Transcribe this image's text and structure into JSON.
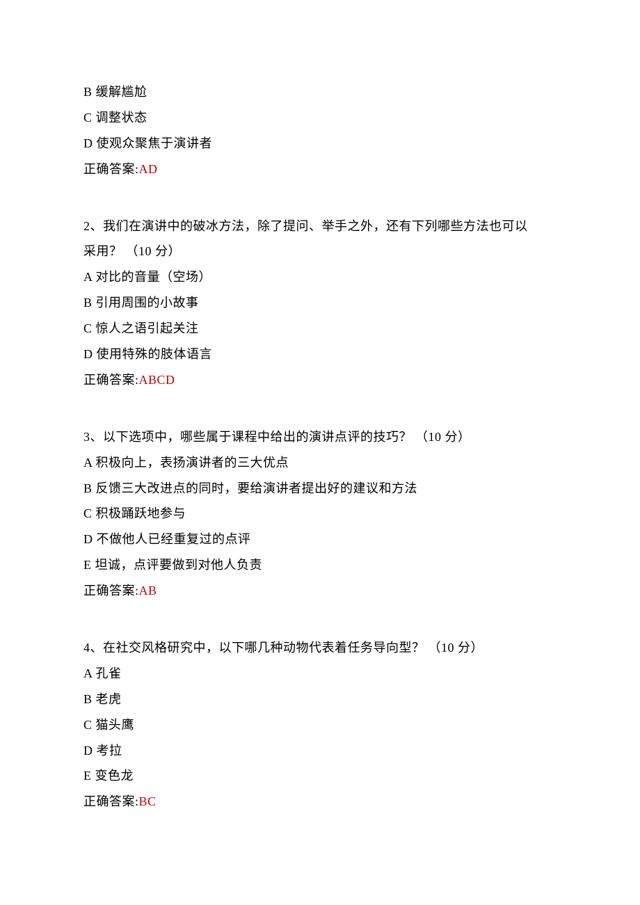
{
  "q1_partial": {
    "option_b": "B 缓解尴尬",
    "option_c": "C 调整状态",
    "option_d": "D 使观众聚焦于演讲者",
    "answer_label": "正确答案:",
    "answer": "AD"
  },
  "q2": {
    "stem_line1": "2、我们在演讲中的破冰方法，除了提问、举手之外，还有下列哪些方法也可以",
    "stem_line2": "采用？ （10 分）",
    "option_a": "A 对比的音量（空场）",
    "option_b": "B 引用周围的小故事",
    "option_c": "C 惊人之语引起关注",
    "option_d": "D 使用特殊的肢体语言",
    "answer_label": "正确答案:",
    "answer": "ABCD"
  },
  "q3": {
    "stem": "3、以下选项中，哪些属于课程中给出的演讲点评的技巧？ （10 分）",
    "option_a": "A 积极向上，表扬演讲者的三大优点",
    "option_b": "B 反馈三大改进点的同时，要给演讲者提出好的建议和方法",
    "option_c": "C 积极踊跃地参与",
    "option_d": "D 不做他人已经重复过的点评",
    "option_e": "E 坦诚，点评要做到对他人负责",
    "answer_label": "正确答案:",
    "answer": "AB"
  },
  "q4": {
    "stem": "4、在社交风格研究中，以下哪几种动物代表着任务导向型？ （10 分）",
    "option_a": "A 孔雀",
    "option_b": "B 老虎",
    "option_c": "C 猫头鹰",
    "option_d": "D 考拉",
    "option_e": "E 变色龙",
    "answer_label": "正确答案:",
    "answer": "BC"
  }
}
